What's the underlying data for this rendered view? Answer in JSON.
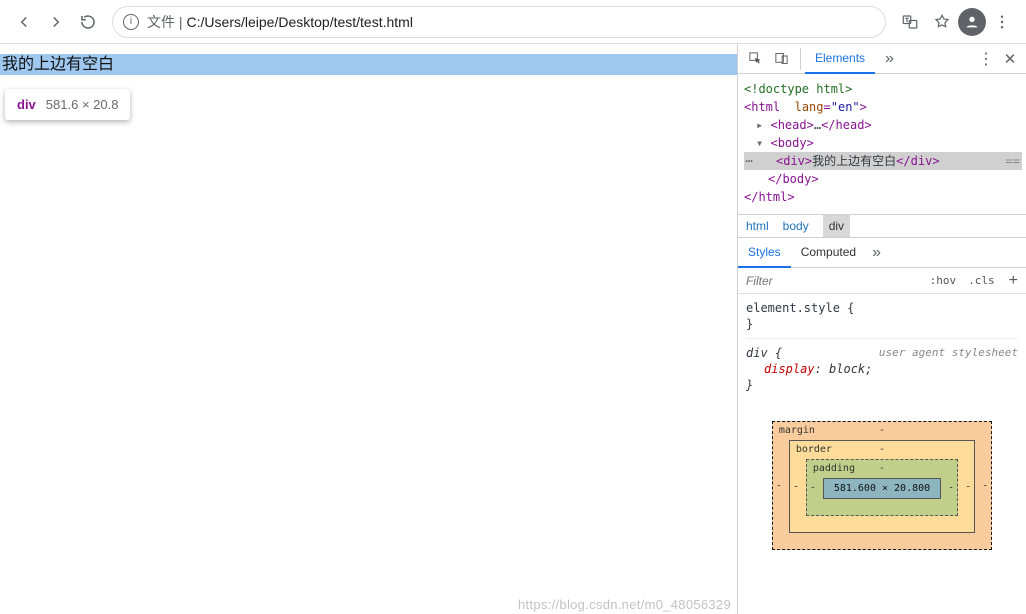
{
  "toolbar": {
    "url_scheme_label": "文件 |",
    "url_path": "C:/Users/leipe/Desktop/test/test.html"
  },
  "page": {
    "highlighted_text": "我的上边有空白",
    "tooltip_tag": "div",
    "tooltip_dim": "581.6 × 20.8"
  },
  "devtools": {
    "tabs": {
      "elements": "Elements"
    },
    "dom": {
      "doctype": "<!doctype html>",
      "html_open_tag": "html",
      "html_lang_attr": "lang",
      "html_lang_val": "\"en\"",
      "head_open": "head",
      "head_ellipsis": "…",
      "head_close": "head",
      "body_open": "body",
      "selected_div_tag": "div",
      "selected_div_text": "我的上边有空白",
      "body_close": "body",
      "html_close": "html"
    },
    "crumb": {
      "a": "html",
      "b": "body",
      "c": "div"
    },
    "styles_tabs": {
      "styles": "Styles",
      "computed": "Computed"
    },
    "filter": {
      "placeholder": "Filter",
      "hov": ":hov",
      "cls": ".cls"
    },
    "rules": {
      "element_style_sel": "element.style {",
      "element_style_end": "}",
      "div_sel": "div {",
      "ua_label": "user agent stylesheet",
      "display_name": "display",
      "display_val": "block",
      "div_end": "}"
    },
    "boxmodel": {
      "margin_label": "margin",
      "border_label": "border",
      "padding_label": "padding",
      "content_size": "581.600 × 20.800",
      "dash": "-"
    }
  },
  "watermark": "https://blog.csdn.net/m0_48056329"
}
